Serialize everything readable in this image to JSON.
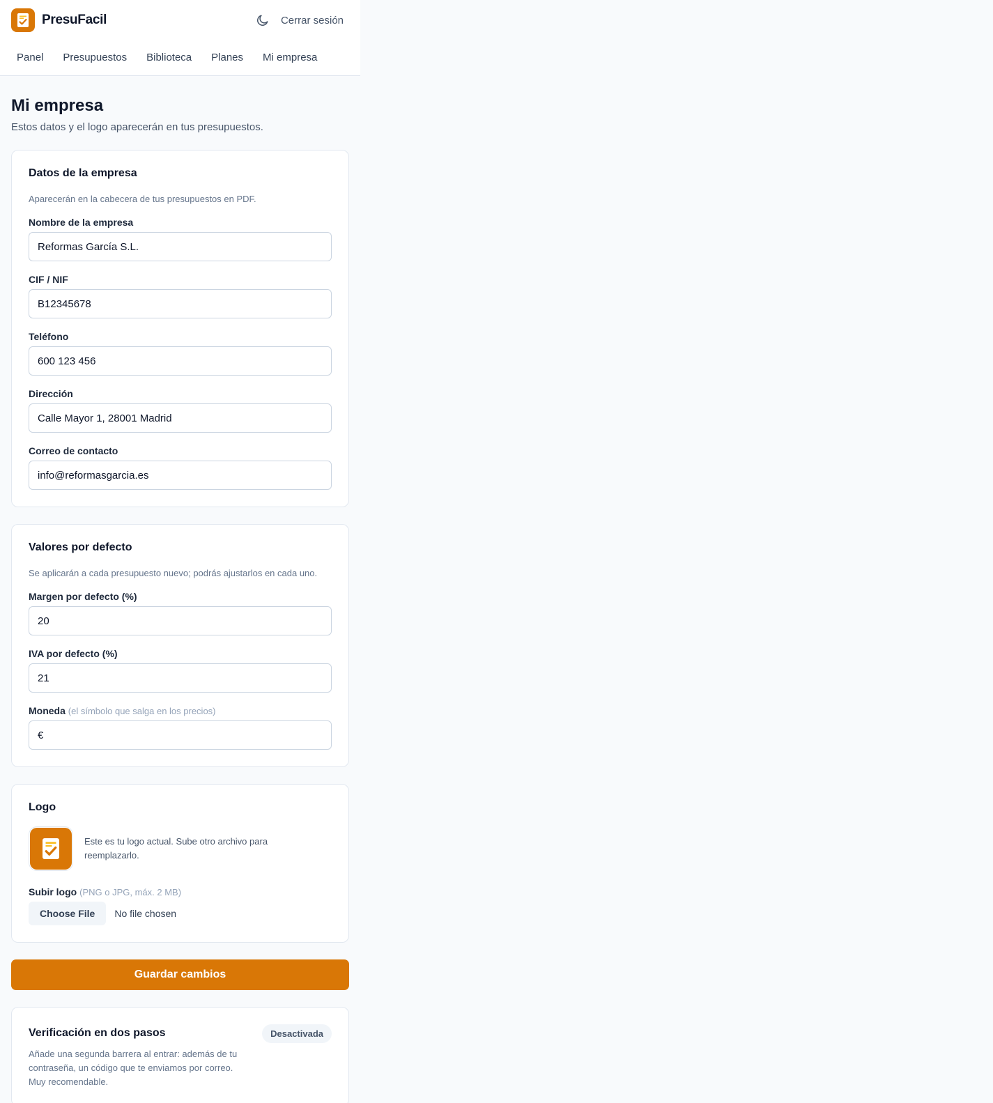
{
  "brand": {
    "name": "PresuFacil",
    "accent": "#d97706"
  },
  "header": {
    "theme_icon": "moon-icon",
    "logout_label": "Cerrar sesión"
  },
  "nav": {
    "items": [
      {
        "label": "Panel"
      },
      {
        "label": "Presupuestos"
      },
      {
        "label": "Biblioteca"
      },
      {
        "label": "Planes"
      },
      {
        "label": "Mi empresa"
      }
    ]
  },
  "page": {
    "title": "Mi empresa",
    "subtitle": "Estos datos y el logo aparecerán en tus presupuestos."
  },
  "company": {
    "title": "Datos de la empresa",
    "description": "Aparecerán en la cabecera de tus presupuestos en PDF.",
    "fields": [
      {
        "label": "Nombre de la empresa",
        "value": "Reformas García S.L."
      },
      {
        "label": "CIF / NIF",
        "value": "B12345678"
      },
      {
        "label": "Teléfono",
        "value": "600 123 456"
      },
      {
        "label": "Dirección",
        "value": "Calle Mayor 1, 28001 Madrid"
      },
      {
        "label": "Correo de contacto",
        "value": "info@reformasgarcia.es"
      }
    ]
  },
  "defaults": {
    "title": "Valores por defecto",
    "description": "Se aplicarán a cada presupuesto nuevo; podrás ajustarlos en cada uno.",
    "margin": {
      "label": "Margen por defecto (%)",
      "value": "20"
    },
    "vat": {
      "label": "IVA por defecto (%)",
      "value": "21"
    },
    "currency": {
      "label": "Moneda",
      "hint": "(el símbolo que salga en los precios)",
      "value": "€"
    }
  },
  "logo": {
    "title": "Logo",
    "current_text": "Este es tu logo actual. Sube otro archivo para reemplazarlo.",
    "upload_label": "Subir logo",
    "upload_hint": "(PNG o JPG, máx. 2 MB)",
    "choose_file": "Choose File",
    "no_file": "No file chosen"
  },
  "save_label": "Guardar cambios",
  "twofa": {
    "title": "Verificación en dos pasos",
    "badge": "Desactivada",
    "description": "Añade una segunda barrera al entrar: además de tu contraseña, un código que te enviamos por correo. Muy recomendable."
  }
}
